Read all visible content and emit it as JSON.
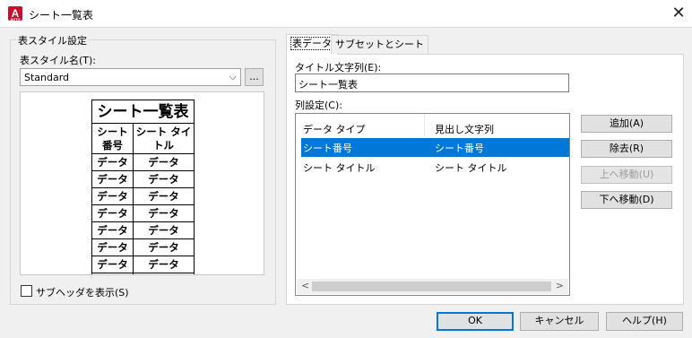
{
  "window": {
    "title": "シート一覧表",
    "close_glyph": "✕",
    "app_icon_letter": "A",
    "app_icon_sub": "AUTO"
  },
  "left": {
    "group_label": "表スタイル設定",
    "style_name_label": "表スタイル名(T):",
    "style_name_value": "Standard",
    "browse_button": "...",
    "preview": {
      "title": "シート一覧表",
      "header_col1": "シート番号",
      "header_col2": "シート タイトル",
      "cell": "データ",
      "row_count": 8
    },
    "subheader_checkbox_label": "サブヘッダを表示(S)",
    "subheader_checked": false
  },
  "tabs": [
    {
      "label": "表データ",
      "active": true
    },
    {
      "label": "サブセットとシート",
      "active": false
    }
  ],
  "table_data": {
    "title_string_label": "タイトル文字列(E):",
    "title_string_value": "シート一覧表",
    "column_settings_label": "列設定(C):",
    "columns": [
      "データ タイプ",
      "見出し文字列"
    ],
    "rows": [
      {
        "data_type": "シート番号",
        "heading": "シート番号",
        "selected": true
      },
      {
        "data_type": "シート タイトル",
        "heading": "シート タイトル",
        "selected": false
      }
    ]
  },
  "side_buttons": {
    "add": "追加(A)",
    "remove": "除去(R)",
    "move_up": "上へ移動(U)",
    "move_down": "下へ移動(D)"
  },
  "footer": {
    "ok": "OK",
    "cancel": "キャンセル",
    "help": "ヘルプ(H)"
  },
  "colors": {
    "selection": "#0078d7",
    "app_icon": "#c8102e"
  }
}
